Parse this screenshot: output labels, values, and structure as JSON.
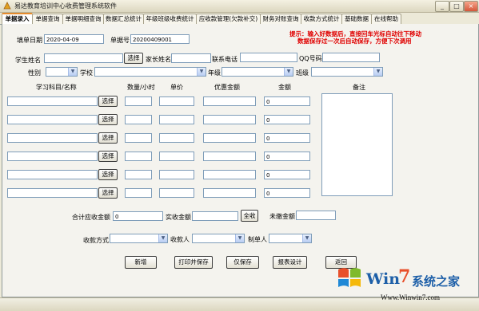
{
  "window": {
    "title": "易达教育培训中心收费管理系统软件",
    "min": "_",
    "max": "□",
    "close": "×"
  },
  "tabs": [
    "单据录入",
    "单据查询",
    "单据明细查询",
    "数据汇总统计",
    "年级班级收费统计",
    "应收款管理(欠款补交)",
    "财务对账查询",
    "收款方式统计",
    "基础数据",
    "在线帮助"
  ],
  "form": {
    "date_label": "填单日期",
    "date_value": "2020-04-09",
    "receipt_label": "单据号",
    "receipt_value": "20200409001",
    "tip_line1": "提示：输入好数据后，直接回车光标自动往下移动",
    "tip_line2": "数据保存过一次后自动保存，方便下次调用",
    "student_label": "学生姓名",
    "select_btn": "选择",
    "parent_label": "家长姓名",
    "phone_label": "联系电话",
    "qq_label": "QQ号码",
    "gender_label": "性别",
    "school_label": "学校",
    "grade_label": "年级",
    "class_label": "班级",
    "col_subject": "学习科目/名称",
    "col_qty": "数量/小时",
    "col_price": "单价",
    "col_discount": "优惠金额",
    "col_amount": "金额",
    "col_note": "备注",
    "amounts": [
      "0",
      "0",
      "0",
      "0",
      "0",
      "0"
    ],
    "total_due_label": "合计应收金额",
    "total_due_value": "0",
    "paid_label": "实收金额",
    "paid_btn": "全收",
    "unpaid_label": "未缴金额",
    "pay_method_label": "收款方式",
    "payee_label": "收款人",
    "maker_label": "制单人"
  },
  "actions": {
    "new": "新增",
    "print_save": "打印并保存",
    "save_only": "仅保存",
    "report": "报表设计",
    "back": "返回"
  },
  "watermark": {
    "brand1": "Win",
    "brand2": "7",
    "brand3": "系统之家",
    "url": "Www.Winwin7.com"
  }
}
